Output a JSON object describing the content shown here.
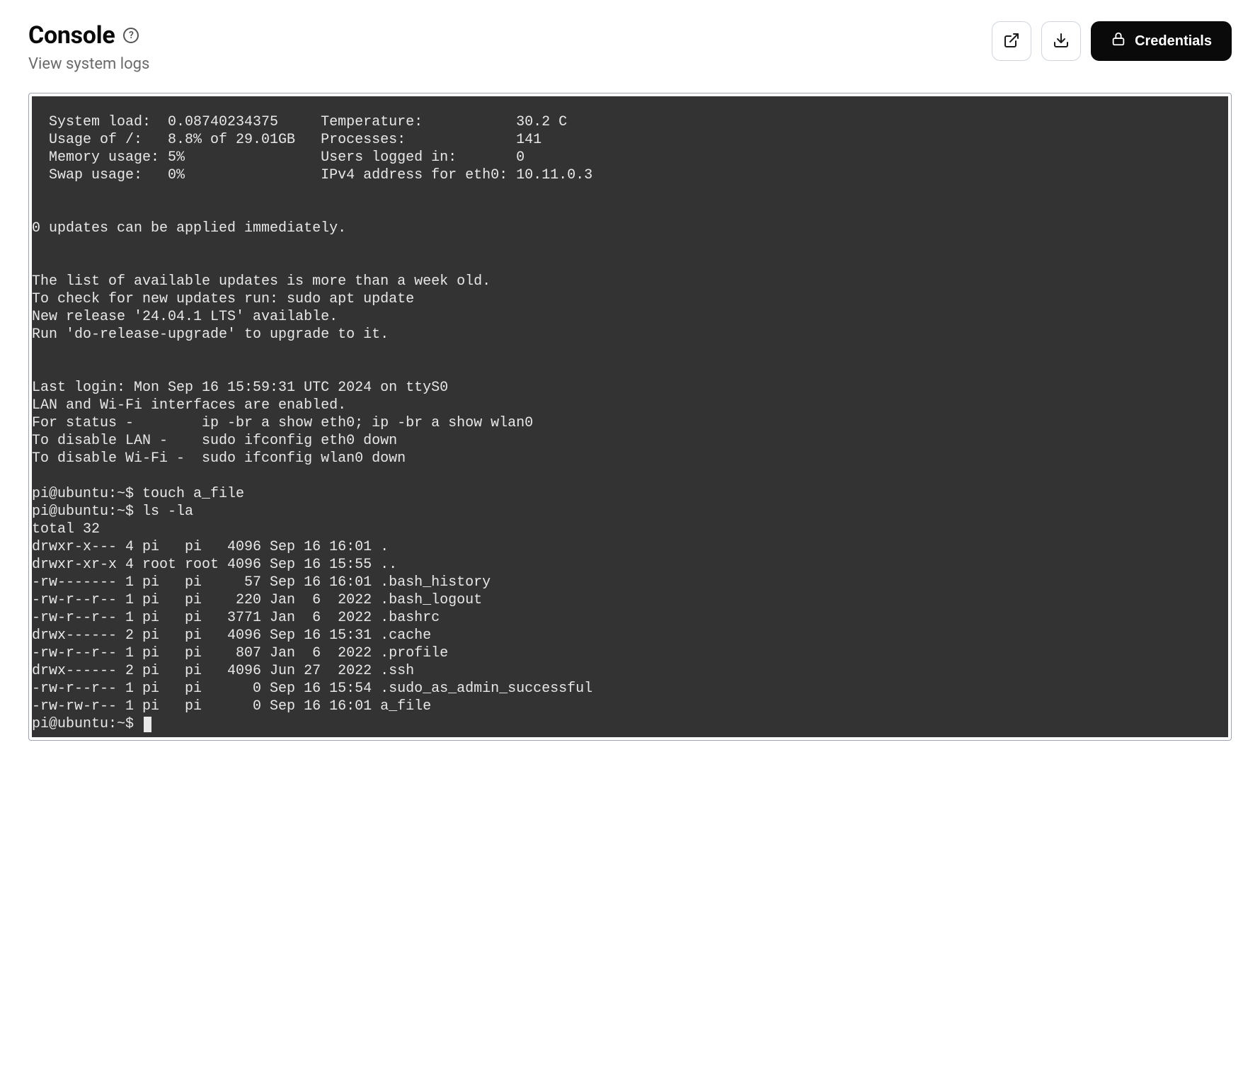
{
  "header": {
    "title": "Console",
    "subtitle": "View system logs",
    "help_glyph": "?",
    "credentials_label": "Credentials"
  },
  "terminal": {
    "stats": {
      "system_load_label": "System load:",
      "system_load_value": "0.08740234375",
      "temperature_label": "Temperature:",
      "temperature_value": "30.2 C",
      "usage_label": "Usage of /:",
      "usage_value": "8.8% of 29.01GB",
      "processes_label": "Processes:",
      "processes_value": "141",
      "memory_label": "Memory usage:",
      "memory_value": "5%",
      "users_label": "Users logged in:",
      "users_value": "0",
      "swap_label": "Swap usage:",
      "swap_value": "0%",
      "ipv4_label": "IPv4 address for eth0:",
      "ipv4_value": "10.11.0.3"
    },
    "updates_line": "0 updates can be applied immediately.",
    "update_info": [
      "The list of available updates is more than a week old.",
      "To check for new updates run: sudo apt update",
      "New release '24.04.1 LTS' available.",
      "Run 'do-release-upgrade' to upgrade to it."
    ],
    "login_info": [
      "Last login: Mon Sep 16 15:59:31 UTC 2024 on ttyS0",
      "LAN and Wi-Fi interfaces are enabled.",
      "For status -        ip -br a show eth0; ip -br a show wlan0",
      "To disable LAN -    sudo ifconfig eth0 down",
      "To disable Wi-Fi -  sudo ifconfig wlan0 down"
    ],
    "prompt": "pi@ubuntu:~$",
    "commands": [
      "touch a_file",
      "ls -la"
    ],
    "ls_total": "total 32",
    "ls_rows": [
      "drwxr-x--- 4 pi   pi   4096 Sep 16 16:01 .",
      "drwxr-xr-x 4 root root 4096 Sep 16 15:55 ..",
      "-rw------- 1 pi   pi     57 Sep 16 16:01 .bash_history",
      "-rw-r--r-- 1 pi   pi    220 Jan  6  2022 .bash_logout",
      "-rw-r--r-- 1 pi   pi   3771 Jan  6  2022 .bashrc",
      "drwx------ 2 pi   pi   4096 Sep 16 15:31 .cache",
      "-rw-r--r-- 1 pi   pi    807 Jan  6  2022 .profile",
      "drwx------ 2 pi   pi   4096 Jun 27  2022 .ssh",
      "-rw-r--r-- 1 pi   pi      0 Sep 16 15:54 .sudo_as_admin_successful",
      "-rw-rw-r-- 1 pi   pi      0 Sep 16 16:01 a_file"
    ]
  }
}
